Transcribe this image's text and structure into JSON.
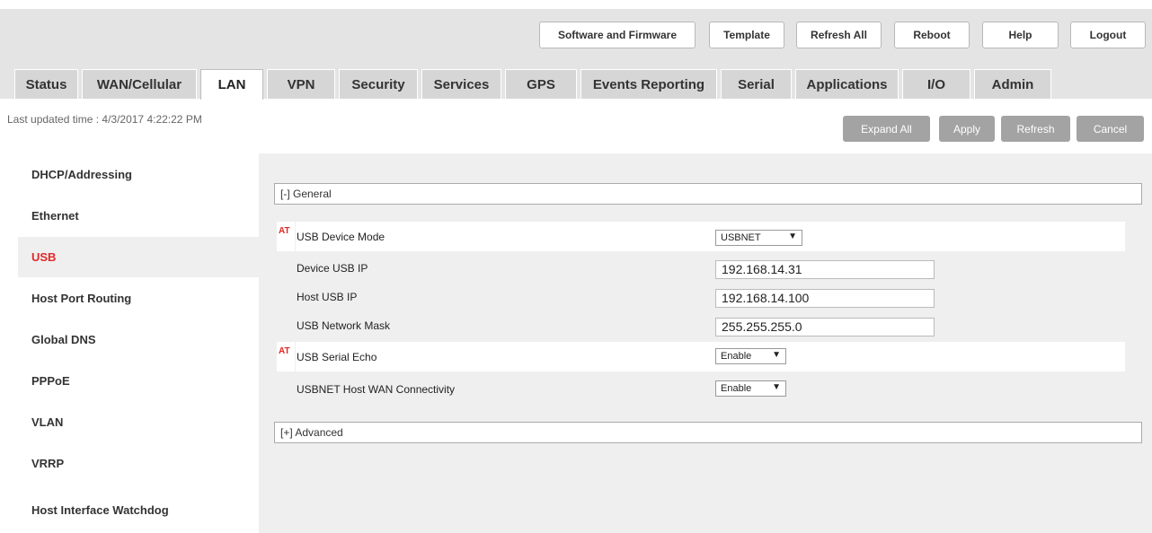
{
  "toolbar": {
    "software_firmware": "Software and Firmware",
    "template": "Template",
    "refresh_all": "Refresh All",
    "reboot": "Reboot",
    "help": "Help",
    "logout": "Logout"
  },
  "tabs": [
    "Status",
    "WAN/Cellular",
    "LAN",
    "VPN",
    "Security",
    "Services",
    "GPS",
    "Events Reporting",
    "Serial",
    "Applications",
    "I/O",
    "Admin"
  ],
  "active_tab": "LAN",
  "last_updated": "Last updated time : 4/3/2017 4:22:22 PM",
  "actions": {
    "expand_all": "Expand All",
    "apply": "Apply",
    "refresh": "Refresh",
    "cancel": "Cancel"
  },
  "sidebar": {
    "items": [
      "DHCP/Addressing",
      "Ethernet",
      "USB",
      "Host Port Routing",
      "Global DNS",
      "PPPoE",
      "VLAN",
      "VRRP",
      "Host Interface Watchdog"
    ],
    "active": "USB"
  },
  "sections": {
    "general": "[-] General",
    "advanced": "[+] Advanced"
  },
  "at_marker": "AT",
  "fields": [
    {
      "label": "USB Device Mode",
      "at": true,
      "type": "select",
      "value": "USBNET"
    },
    {
      "label": "Device USB IP",
      "at": false,
      "type": "text",
      "value": "192.168.14.31"
    },
    {
      "label": "Host USB IP",
      "at": false,
      "type": "text",
      "value": "192.168.14.100"
    },
    {
      "label": "USB Network Mask",
      "at": false,
      "type": "text",
      "value": "255.255.255.0"
    },
    {
      "label": "USB Serial Echo",
      "at": true,
      "type": "select",
      "value": "Enable"
    },
    {
      "label": "USBNET Host WAN Connectivity",
      "at": false,
      "type": "select",
      "value": "Enable"
    }
  ],
  "colors": {
    "accent_red": "#e02828",
    "action_button": "#a3a3a3",
    "topbar": "#e4e4e4"
  }
}
